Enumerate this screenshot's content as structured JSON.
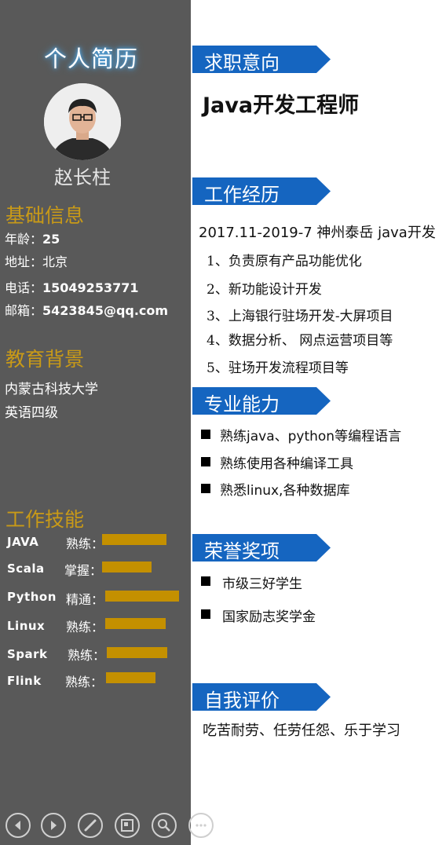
{
  "sidebar": {
    "title": "个人简历",
    "name": "赵长柱",
    "basic_info": {
      "heading": "基础信息",
      "items": [
        {
          "key": "年龄：",
          "value": "25"
        },
        {
          "key": "地址：",
          "value": "北京"
        },
        {
          "key": "电话：",
          "value": "15049253771"
        },
        {
          "key": "邮箱：",
          "value": "5423845@qq.com"
        }
      ]
    },
    "education": {
      "heading": "教育背景",
      "lines": [
        "内蒙古科技大学",
        "英语四级"
      ]
    },
    "skills": {
      "heading": "工作技能",
      "items": [
        {
          "name": "JAVA",
          "level": "熟练：",
          "proficiency": 0.8
        },
        {
          "name": "Scala",
          "level": "掌握：",
          "proficiency": 0.62
        },
        {
          "name": "Python",
          "level": "精通：",
          "proficiency": 0.92
        },
        {
          "name": "Linux",
          "level": "熟练：",
          "proficiency": 0.75
        },
        {
          "name": "Spark",
          "level": "熟练：",
          "proficiency": 0.75
        },
        {
          "name": "Flink",
          "level": "熟练：",
          "proficiency": 0.62
        }
      ]
    }
  },
  "main": {
    "objective": {
      "heading": "求职意向",
      "job": "Java开发工程师"
    },
    "experience": {
      "heading": "工作经历",
      "period": "2017.11-2019-7 神州泰岳 java开发",
      "items": [
        "1、负责原有产品功能优化",
        "2、新功能设计开发",
        "3、上海银行驻场开发-大屏项目",
        "4、数据分析、 网点运营项目等",
        "5、驻场开发流程项目等"
      ]
    },
    "abilities": {
      "heading": "专业能力",
      "items": [
        "熟练java、python等编程语言",
        "熟练使用各种编译工具",
        "熟悉linux,各种数据库"
      ]
    },
    "honors": {
      "heading": "荣誉奖项",
      "items": [
        "市级三好学生",
        "国家励志奖学金"
      ]
    },
    "self_evaluation": {
      "heading": "自我评价",
      "text": "吃苦耐劳、任劳任怨、乐于学习"
    }
  },
  "controls": [
    "back-icon",
    "forward-icon",
    "pen-icon",
    "slides-icon",
    "zoom-icon",
    "more-icon"
  ],
  "colors": {
    "sidebar": "#595959",
    "accent_gold": "#c99a17",
    "bar": "#c49000",
    "banner_blue": "#1565c0"
  }
}
